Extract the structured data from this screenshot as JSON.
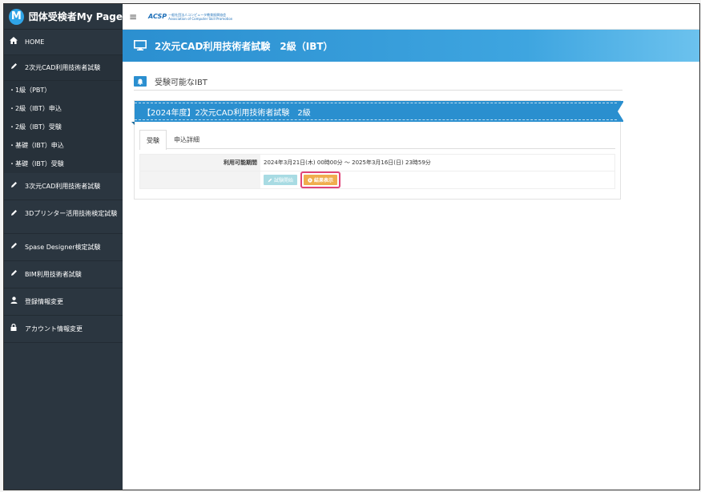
{
  "brand": {
    "logo_letter": "M",
    "title": "団体受検者My Page"
  },
  "topbar": {
    "menu_icon": "hamburger-icon",
    "org_mark": "ACSP",
    "org_name_jp": "一般社団法人コンピュータ教育振興協会",
    "org_name_en": "Association of Computer Skill Promotion"
  },
  "sidebar": {
    "home": {
      "icon": "home-icon",
      "label": "HOME"
    },
    "cad2": {
      "icon": "pencil-icon",
      "label": "2次元CAD利用技術者試験",
      "subitems": [
        "・1級（PBT）",
        "・2級（IBT）申込",
        "・2級（IBT）受験",
        "・基礎（IBT）申込",
        "・基礎（IBT）受験"
      ]
    },
    "items": [
      {
        "icon": "pencil-icon",
        "label": "3次元CAD利用技術者試験"
      },
      {
        "icon": "pencil-icon",
        "label": "3Dプリンター活用技術検定試験"
      },
      {
        "icon": "pencil-icon",
        "label": "Spase Designer検定試験"
      },
      {
        "icon": "pencil-icon",
        "label": "BIM利用技術者試験"
      },
      {
        "icon": "user-icon",
        "label": "登録情報変更"
      },
      {
        "icon": "lock-icon",
        "label": "アカウント情報変更"
      }
    ]
  },
  "header": {
    "icon": "monitor-icon",
    "title": "2次元CAD利用技術者試験　2級（IBT）"
  },
  "section": {
    "icon": "bell-icon",
    "title": "受験可能なIBT"
  },
  "panel": {
    "ribbon_title": "【2024年度】2次元CAD利用技術者試験　2級",
    "tabs": [
      {
        "label": "受験",
        "active": true
      },
      {
        "label": "申込詳細",
        "active": false
      }
    ],
    "period_label": "利用可能期間",
    "period_value": "2024年3月21日(木) 00時00分 ～ 2025年3月16日(日) 23時59分",
    "start_button": "試験開始",
    "result_button": "結果表示"
  },
  "colors": {
    "sidebar_bg": "#2b3640",
    "header_blue": "#2b8fd0",
    "ribbon_blue": "#2a8fcf",
    "result_orange": "#f0ad4e",
    "highlight_pink": "#e0457a",
    "disabled_teal": "#a8dbe3"
  }
}
